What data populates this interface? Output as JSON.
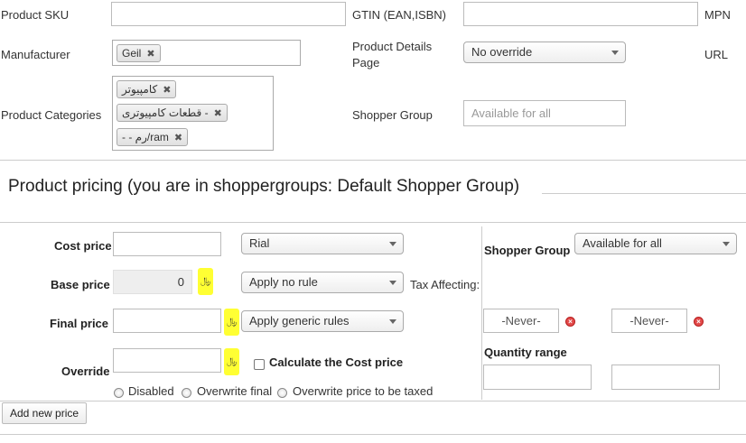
{
  "product": {
    "sku_label": "Product SKU",
    "sku_value": "",
    "gtin_label": "GTIN (EAN,ISBN)",
    "gtin_value": "",
    "mpn_label": "MPN",
    "manufacturer_label": "Manufacturer",
    "manufacturer_chip": "Geil",
    "details_page_label_line1": "Product Details",
    "details_page_label_line2": "Page",
    "details_page_value": "No override",
    "url_label": "URL",
    "categories_label": "Product Categories",
    "categories": [
      "کامپیوتر",
      "قطعات کامپیوتری -",
      "- - رم/ram"
    ],
    "shopper_group_label": "Shopper Group",
    "shopper_group_placeholder": "Available for all"
  },
  "pricing": {
    "section_title": "Product pricing (you are in shoppergroups: Default Shopper Group)",
    "cost_price_label": "Cost price",
    "cost_price_value": "",
    "currency_value": "Rial",
    "base_price_label": "Base price",
    "base_price_value": "0",
    "currency_symbol": "﷼",
    "tax_rule_value": "Apply no rule",
    "tax_affecting_label": "Tax Affecting:",
    "final_price_label": "Final price",
    "final_price_value": "",
    "discount_rule_value": "Apply generic rules",
    "override_label": "Override",
    "override_value": "",
    "calc_cost_label": "Calculate the Cost price",
    "radio_disabled": "Disabled",
    "radio_overwrite_final": "Overwrite final",
    "radio_overwrite_taxed": "Overwrite price to be taxed",
    "shopper_group_label": "Shopper Group",
    "shopper_group_value": "Available for all",
    "date_from": "-Never-",
    "date_to": "-Never-",
    "delete_glyph": "×",
    "quantity_range_label": "Quantity range",
    "add_new_price": "Add new price"
  }
}
